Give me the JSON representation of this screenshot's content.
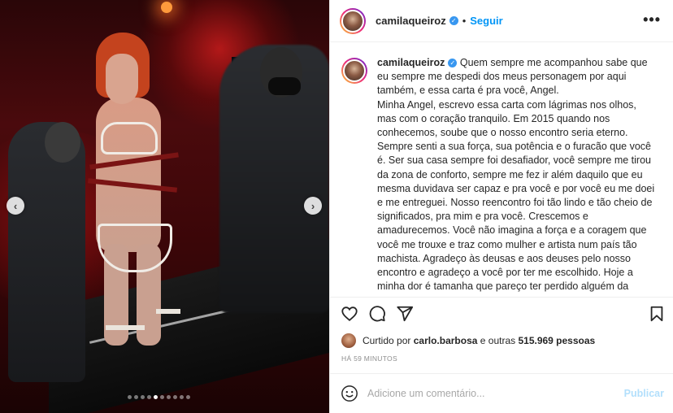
{
  "post": {
    "media": {
      "carousel_total": 10,
      "carousel_active_index": 5
    },
    "header": {
      "username": "camilaqueiroz",
      "separator": "•",
      "follow_label": "Seguir",
      "more_label": "•••"
    },
    "caption": {
      "username": "camilaqueiroz",
      "text": "Quem sempre me acompanhou sabe que eu sempre me despedi dos meus personagem por aqui também, e essa carta é pra você, Angel.",
      "text2": "Minha Angel, escrevo essa carta com lágrimas nos olhos, mas com o coração tranquilo. Em 2015 quando nos conhecemos, soube que o nosso encontro seria eterno. Sempre senti a sua força, sua potência e o furacão que você é. Ser sua casa sempre foi desafiador, você sempre me tirou da zona de conforto, sempre me fez ir além daquilo que eu mesma duvidava ser capaz e pra você e por você eu me doei e me entreguei. Nosso reencontro foi tão lindo e tão cheio de significados, pra mim e pra você. Crescemos e amadurecemos. Você não imagina a força e a coragem que você me trouxe e traz como mulher e artista num país tão machista. Agradeço às deusas e aos deuses pelo nosso encontro e agradeço a você por ter me escolhido. Hoje a minha dor é tamanha que pareço ter perdido alguém da família, mas na verdade não, porque você é ETERNA, você é GIGANTE e você SEMPRE estará comigo e com todos que viveram com a gente a sua história. Desculpa não ter me despedido de você como você merecia, não me permitiram, mas no meu coração e na"
    },
    "likes": {
      "prefix": "Curtido por",
      "user": "carlo.barbosa",
      "middle": "e outras",
      "count": "515.969 pessoas"
    },
    "time_ago": "HÁ 59 MINUTOS",
    "comment": {
      "placeholder": "Adicione um comentário...",
      "publish_label": "Publicar"
    },
    "icons": [
      "chevron-left-icon",
      "chevron-right-icon",
      "verified-icon",
      "more-icon",
      "heart-icon",
      "comment-icon",
      "share-icon",
      "bookmark-icon",
      "smile-icon"
    ],
    "colors": {
      "link_blue": "#0095f6",
      "verified_blue": "#3897f0",
      "publish_disabled": "#b2dffc",
      "muted_gray": "#8e8e8e"
    }
  }
}
